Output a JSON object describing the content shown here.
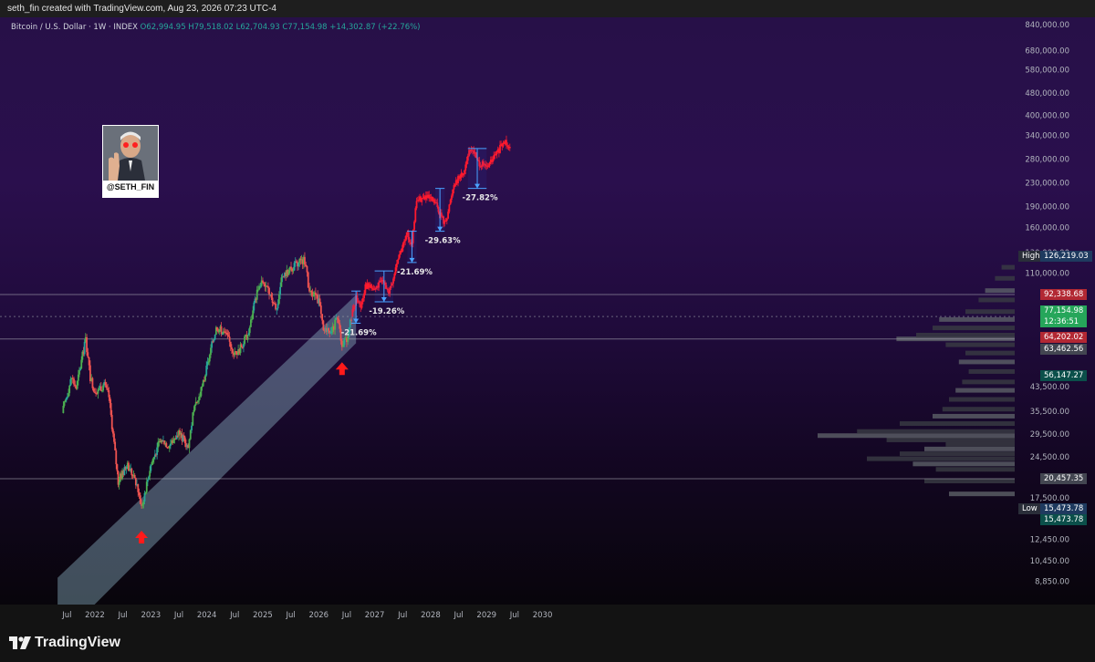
{
  "header": {
    "caption": "seth_fin created with TradingView.com, Aug 23, 2026 07:23 UTC-4"
  },
  "legend": {
    "symbol": "Bitcoin / U.S. Dollar · 1W · INDEX",
    "ohlc": "O62,994.95 H79,518.02 L62,704.93 C77,154.98 +14,302.87 (+22.76%)"
  },
  "avatar": {
    "handle": "@SETH_FIN"
  },
  "colors": {
    "up": "#26a69a",
    "up_bright": "#4caf50",
    "down": "#ef5350",
    "projection": "#ff1a2e",
    "channel": "#8fb7c9",
    "accent": "#2962ff"
  },
  "price_axis": {
    "scale": "log",
    "ticks": [
      "840,000.00",
      "680,000.00",
      "580,000.00",
      "480,000.00",
      "400,000.00",
      "340,000.00",
      "280,000.00",
      "230,000.00",
      "190,000.00",
      "160,000.00",
      "130,000.00",
      "110,000.00",
      "43,500.00",
      "35,500.00",
      "29,500.00",
      "24,500.00",
      "17,500.00",
      "12,450.00",
      "10,450.00",
      "8,850.00"
    ]
  },
  "x_axis": {
    "labels": [
      "Jul",
      "2022",
      "Jul",
      "2023",
      "Jul",
      "2024",
      "Jul",
      "2025",
      "Jul",
      "2026",
      "Jul",
      "2027",
      "Jul",
      "2028",
      "Jul",
      "2029",
      "Jul",
      "2030"
    ]
  },
  "price_tags": [
    {
      "key": "high",
      "label": "High",
      "value": "126,219.03",
      "bg": "#1e3a5f"
    },
    {
      "key": "resist",
      "value": "92,338.68",
      "bg": "#b22833"
    },
    {
      "key": "last",
      "value": "77,154.98",
      "sub": "12:36:51",
      "bg": "#26a65a"
    },
    {
      "key": "open",
      "value": "64,202.02",
      "bg": "#b22833"
    },
    {
      "key": "poc",
      "value": "63,462.56",
      "bg": "#434651"
    },
    {
      "key": "mid",
      "value": "56,147.27",
      "bg": "#0b4f4a"
    },
    {
      "key": "support",
      "value": "20,457.35",
      "bg": "#434651"
    },
    {
      "key": "low",
      "label": "Low",
      "value": "15,473.78",
      "bg": "#1e3a5f"
    },
    {
      "key": "low2",
      "value": "15,473.78",
      "bg": "#0b4f4a"
    }
  ],
  "annotations": {
    "drawdowns": [
      "-21.69%",
      "-19.26%",
      "-21.69%",
      "-29.63%",
      "-27.82%"
    ]
  },
  "footer": {
    "brand": "TradingView"
  },
  "chart_data": {
    "type": "candlestick",
    "title": "Bitcoin / U.S. Dollar · 1W · INDEX",
    "yscale": "log",
    "ylim": [
      8000,
      900000
    ],
    "xlim": [
      "2021-05",
      "2030-03"
    ],
    "grid": false,
    "historical_path": [
      [
        "2021-06",
        35000
      ],
      [
        "2021-08",
        47000
      ],
      [
        "2021-09",
        43000
      ],
      [
        "2021-11",
        64000
      ],
      [
        "2021-12",
        47000
      ],
      [
        "2022-01",
        42000
      ],
      [
        "2022-03",
        44000
      ],
      [
        "2022-04",
        40000
      ],
      [
        "2022-06",
        20000
      ],
      [
        "2022-08",
        23000
      ],
      [
        "2022-10",
        19500
      ],
      [
        "2022-11",
        16200
      ],
      [
        "2023-01",
        23000
      ],
      [
        "2023-03",
        28000
      ],
      [
        "2023-05",
        27000
      ],
      [
        "2023-07",
        30000
      ],
      [
        "2023-09",
        26500
      ],
      [
        "2023-10",
        34500
      ],
      [
        "2023-12",
        43000
      ],
      [
        "2024-03",
        71000
      ],
      [
        "2024-05",
        67000
      ],
      [
        "2024-07",
        57000
      ],
      [
        "2024-08",
        59000
      ],
      [
        "2024-10",
        68000
      ],
      [
        "2024-12",
        99000
      ],
      [
        "2025-01",
        103000
      ],
      [
        "2025-04",
        82000
      ],
      [
        "2025-05",
        105000
      ],
      [
        "2025-08",
        118000
      ],
      [
        "2025-10",
        122000
      ],
      [
        "2025-11",
        95000
      ],
      [
        "2026-01",
        88000
      ],
      [
        "2026-02",
        68000
      ],
      [
        "2026-04",
        70000
      ],
      [
        "2026-05",
        76000
      ],
      [
        "2026-06",
        62000
      ],
      [
        "2026-07",
        64000
      ],
      [
        "2026-08",
        77155
      ]
    ],
    "projection_path": [
      [
        "2026-08",
        77155
      ],
      [
        "2026-09",
        90000
      ],
      [
        "2026-10",
        84000
      ],
      [
        "2026-11",
        100000
      ],
      [
        "2027-01",
        96000
      ],
      [
        "2027-03",
        105000
      ],
      [
        "2027-04",
        92000
      ],
      [
        "2027-05",
        105000
      ],
      [
        "2027-06",
        125000
      ],
      [
        "2027-08",
        150000
      ],
      [
        "2027-09",
        140000
      ],
      [
        "2027-10",
        200000
      ],
      [
        "2027-12",
        205000
      ],
      [
        "2028-02",
        195000
      ],
      [
        "2028-04",
        165000
      ],
      [
        "2028-05",
        190000
      ],
      [
        "2028-06",
        230000
      ],
      [
        "2028-08",
        250000
      ],
      [
        "2028-09",
        290000
      ],
      [
        "2028-10",
        305000
      ],
      [
        "2028-11",
        275000
      ],
      [
        "2029-01",
        260000
      ],
      [
        "2029-03",
        290000
      ],
      [
        "2029-05",
        325000
      ],
      [
        "2029-06",
        310000
      ]
    ],
    "horizontal_levels": [
      92338.68,
      77154.98,
      64202.02,
      20457.35
    ],
    "channel": {
      "upper": [
        [
          "2021-05",
          9100
        ],
        [
          "2026-09",
          92000
        ]
      ],
      "lower": [
        [
          "2021-05",
          5400
        ],
        [
          "2026-09",
          62000
        ]
      ]
    },
    "drawdown_boxes": [
      {
        "start": "2026-08",
        "end": "2026-10",
        "top": 95000,
        "bottom": 73000,
        "label": "-21.69%"
      },
      {
        "start": "2027-01",
        "end": "2027-05",
        "top": 112000,
        "bottom": 87000,
        "label": "-19.26%"
      },
      {
        "start": "2027-08",
        "end": "2027-10",
        "top": 155000,
        "bottom": 120000,
        "label": "-21.69%"
      },
      {
        "start": "2028-02",
        "end": "2028-04",
        "top": 220000,
        "bottom": 155000,
        "label": "-29.63%"
      },
      {
        "start": "2028-09",
        "end": "2029-01",
        "top": 305000,
        "bottom": 220000,
        "label": "-27.82%"
      }
    ],
    "markers": [
      {
        "type": "arrow-up",
        "date": "2022-11",
        "price": 12600
      },
      {
        "type": "arrow-up",
        "date": "2026-06",
        "price": 50000
      }
    ]
  }
}
